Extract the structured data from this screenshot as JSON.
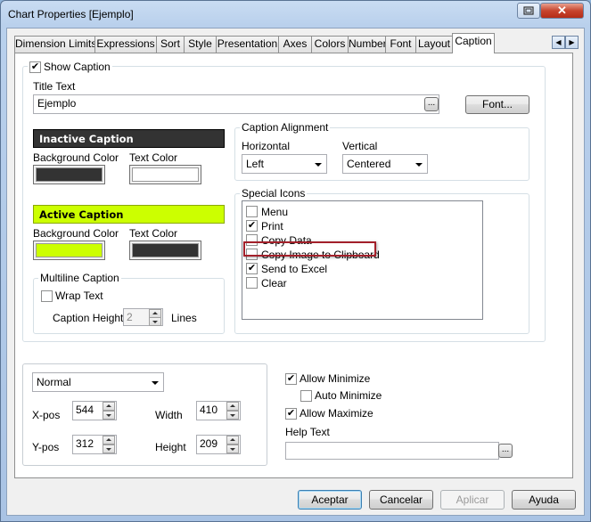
{
  "window": {
    "title": "Chart Properties [Ejemplo]"
  },
  "tabs": [
    "Dimension Limits",
    "Expressions",
    "Sort",
    "Style",
    "Presentation",
    "Axes",
    "Colors",
    "Number",
    "Font",
    "Layout",
    "Caption"
  ],
  "active_tab": "Caption",
  "caption": {
    "show_caption_label": "Show Caption",
    "show_caption_checked": true,
    "title_text_label": "Title Text",
    "title_text_value": "Ejemplo",
    "browse_label": "...",
    "font_button": "Font..."
  },
  "inactive": {
    "header": "Inactive Caption",
    "bg_label": "Background Color",
    "text_label": "Text Color",
    "header_color": "#333333",
    "bg_color": "#333333",
    "text_color": "#ffffff"
  },
  "active": {
    "header": "Active Caption",
    "bg_label": "Background Color",
    "text_label": "Text Color",
    "header_color": "#ccff00",
    "bg_color": "#ccff00",
    "text_color": "#333333"
  },
  "multiline": {
    "group_label": "Multiline Caption",
    "wrap_label": "Wrap Text",
    "wrap_checked": false,
    "height_label": "Caption Height",
    "height_value": "2",
    "lines_label": "Lines"
  },
  "alignment": {
    "group_label": "Caption Alignment",
    "horizontal_label": "Horizontal",
    "horizontal_value": "Left",
    "vertical_label": "Vertical",
    "vertical_value": "Centered"
  },
  "special_icons": {
    "group_label": "Special Icons",
    "items": [
      {
        "label": "Menu",
        "checked": false
      },
      {
        "label": "Print",
        "checked": true
      },
      {
        "label": "Copy Data",
        "checked": false
      },
      {
        "label": "Copy Image to Clipboard",
        "checked": false
      },
      {
        "label": "Send to Excel",
        "checked": true
      },
      {
        "label": "Clear",
        "checked": false
      }
    ]
  },
  "position": {
    "mode_value": "Normal",
    "xpos_label": "X-pos",
    "xpos_value": "544",
    "ypos_label": "Y-pos",
    "ypos_value": "312",
    "width_label": "Width",
    "width_value": "410",
    "height_label": "Height",
    "height_value": "209"
  },
  "options": {
    "allow_minimize_label": "Allow Minimize",
    "allow_minimize_checked": true,
    "auto_minimize_label": "Auto Minimize",
    "auto_minimize_checked": false,
    "allow_maximize_label": "Allow Maximize",
    "allow_maximize_checked": true,
    "help_text_label": "Help Text",
    "help_text_value": ""
  },
  "buttons": {
    "accept": "Aceptar",
    "cancel": "Cancelar",
    "apply": "Aplicar",
    "help": "Ayuda"
  },
  "highlight_color": "#a3202a"
}
